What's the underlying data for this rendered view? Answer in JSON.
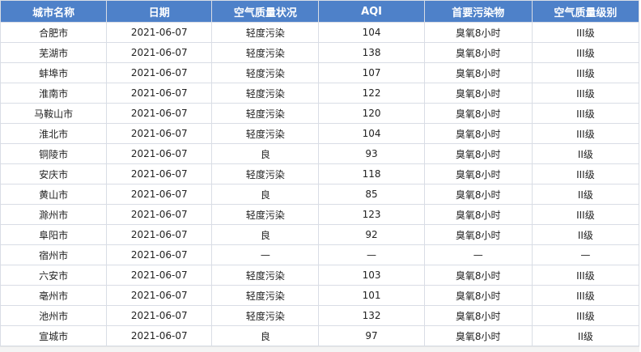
{
  "table": {
    "headers": [
      "城市名称",
      "日期",
      "空气质量状况",
      "AQI",
      "首要污染物",
      "空气质量级别"
    ],
    "rows": [
      [
        "合肥市",
        "2021-06-07",
        "轻度污染",
        "104",
        "臭氧8小时",
        "III级"
      ],
      [
        "芜湖市",
        "2021-06-07",
        "轻度污染",
        "138",
        "臭氧8小时",
        "III级"
      ],
      [
        "蚌埠市",
        "2021-06-07",
        "轻度污染",
        "107",
        "臭氧8小时",
        "III级"
      ],
      [
        "淮南市",
        "2021-06-07",
        "轻度污染",
        "122",
        "臭氧8小时",
        "III级"
      ],
      [
        "马鞍山市",
        "2021-06-07",
        "轻度污染",
        "120",
        "臭氧8小时",
        "III级"
      ],
      [
        "淮北市",
        "2021-06-07",
        "轻度污染",
        "104",
        "臭氧8小时",
        "III级"
      ],
      [
        "铜陵市",
        "2021-06-07",
        "良",
        "93",
        "臭氧8小时",
        "II级"
      ],
      [
        "安庆市",
        "2021-06-07",
        "轻度污染",
        "118",
        "臭氧8小时",
        "III级"
      ],
      [
        "黄山市",
        "2021-06-07",
        "良",
        "85",
        "臭氧8小时",
        "II级"
      ],
      [
        "滁州市",
        "2021-06-07",
        "轻度污染",
        "123",
        "臭氧8小时",
        "III级"
      ],
      [
        "阜阳市",
        "2021-06-07",
        "良",
        "92",
        "臭氧8小时",
        "II级"
      ],
      [
        "宿州市",
        "2021-06-07",
        "—",
        "—",
        "—",
        "—"
      ],
      [
        "六安市",
        "2021-06-07",
        "轻度污染",
        "103",
        "臭氧8小时",
        "III级"
      ],
      [
        "亳州市",
        "2021-06-07",
        "轻度污染",
        "101",
        "臭氧8小时",
        "III级"
      ],
      [
        "池州市",
        "2021-06-07",
        "轻度污染",
        "132",
        "臭氧8小时",
        "III级"
      ],
      [
        "宣城市",
        "2021-06-07",
        "良",
        "97",
        "臭氧8小时",
        "II级"
      ]
    ]
  },
  "colors": {
    "header_bg": "#4e81c9",
    "header_text": "#ffffff",
    "border": "#d9dde5"
  }
}
